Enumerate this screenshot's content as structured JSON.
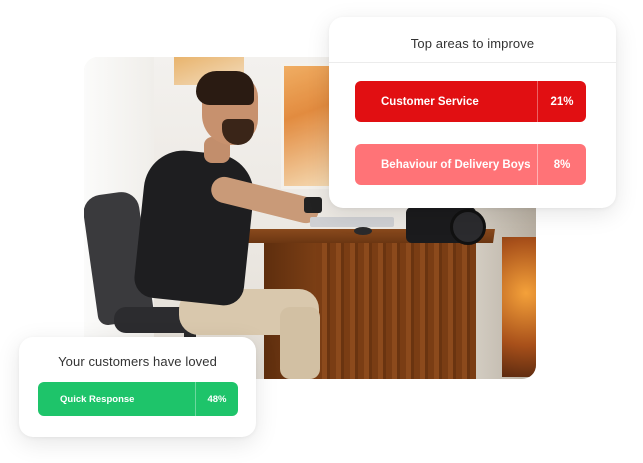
{
  "improve_card": {
    "title": "Top areas to improve",
    "items": [
      {
        "label": "Customer Service",
        "percent": "21%",
        "color": "#e10f12"
      },
      {
        "label": "Behaviour of Delivery Boys",
        "percent": "8%",
        "color": "#ff7377"
      }
    ]
  },
  "loved_card": {
    "title": "Your customers have loved",
    "items": [
      {
        "label": "Quick Response",
        "percent": "48%",
        "color": "#1ec46a"
      }
    ]
  },
  "photo": {
    "icon": "person-working-at-desk-photo"
  }
}
